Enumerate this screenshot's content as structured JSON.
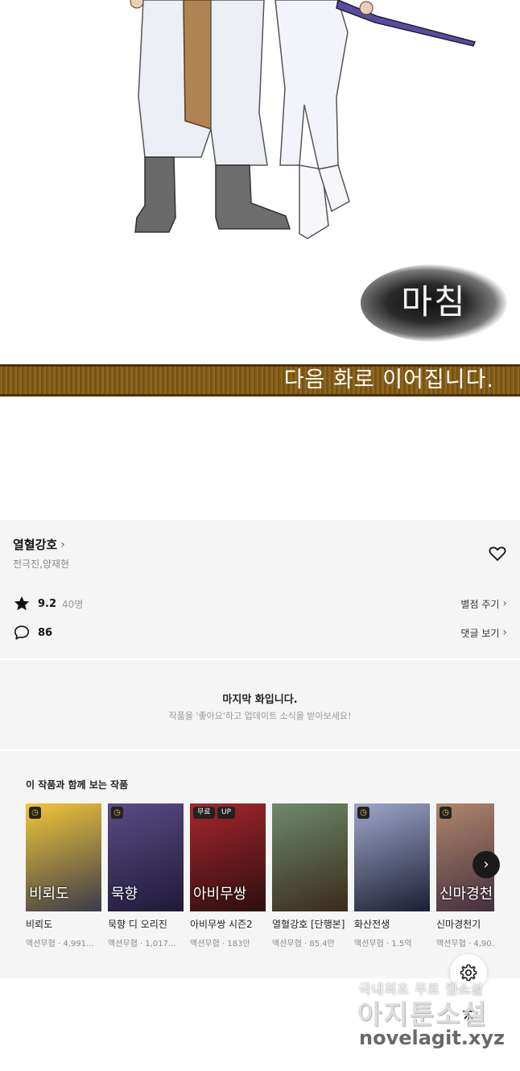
{
  "comic": {
    "ending_text": "마침",
    "continued_text": "다음 화로 이어집니다."
  },
  "series": {
    "title": "열혈강호",
    "authors": "전극진,양재현",
    "rating": "9.2",
    "rating_count": "40명",
    "rate_link": "별점 주기",
    "comment_count": "86",
    "comment_link": "댓글 보기"
  },
  "notice": {
    "title": "마지막 화입니다.",
    "subtitle": "작품을 '좋아요'하고 업데이트 소식을 받아보세요!"
  },
  "recommendations": {
    "heading": "이 작품과 함께 보는 작품",
    "items": [
      {
        "name": "비뢰도",
        "genre": "액션무협",
        "views": "4,991...",
        "cover_text": "비뢰도",
        "badges": [],
        "wait": true,
        "colors": [
          "#f3c738",
          "#3a3a4a"
        ]
      },
      {
        "name": "묵향 디 오리진",
        "genre": "액션무협",
        "views": "1,017...",
        "cover_text": "묵향",
        "badges": [],
        "wait": true,
        "colors": [
          "#5b4b86",
          "#1f1a36"
        ]
      },
      {
        "name": "아비무쌍 시즌2",
        "genre": "액션무협",
        "views": "183만",
        "cover_text": "아비무쌍",
        "badges": [
          "무료",
          "UP"
        ],
        "wait": false,
        "colors": [
          "#a7262b",
          "#2b0f10"
        ]
      },
      {
        "name": "열혈강호 [단행본]",
        "genre": "액션무협",
        "views": "85.4만",
        "cover_text": "",
        "badges": [],
        "wait": false,
        "colors": [
          "#6e8a6a",
          "#3a2a1a"
        ]
      },
      {
        "name": "화산전생",
        "genre": "액션무협",
        "views": "1.5억",
        "cover_text": "",
        "badges": [],
        "wait": true,
        "colors": [
          "#9fa6c9",
          "#1b1e33"
        ]
      },
      {
        "name": "신마경천기",
        "genre": "액션무협",
        "views": "4,90...",
        "cover_text": "신마경천",
        "badges": [],
        "wait": true,
        "colors": [
          "#b0866a",
          "#3f2c3e"
        ]
      }
    ]
  },
  "watermark": {
    "line1": "국내최초 무료 웹소설",
    "line2": "아지툰소설",
    "line3": "novelagit.xyz"
  },
  "icons": {
    "heart": "heart-icon",
    "star": "star-icon",
    "comment": "comment-icon",
    "gear": "gear-icon",
    "top": "arrow-up-icon",
    "next": "chevron-right-icon"
  }
}
